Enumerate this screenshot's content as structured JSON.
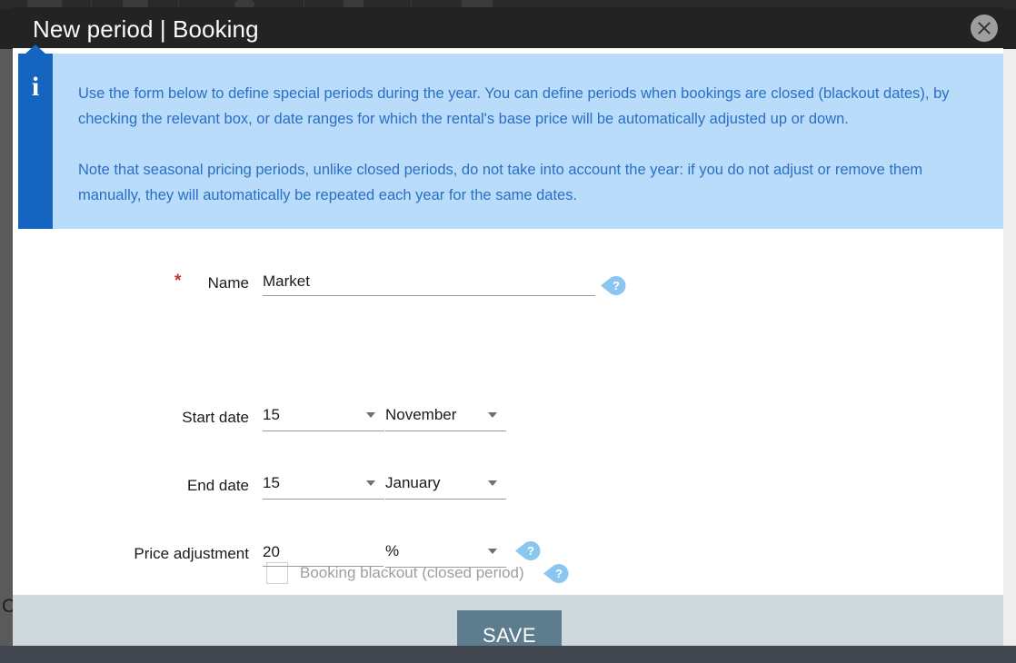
{
  "background": {
    "left_letter": "C"
  },
  "modal": {
    "title": "New period | Booking",
    "close_icon": "close-icon",
    "info": {
      "icon": "info-icon",
      "paragraph1": "Use the form below to define special periods during the year. You can define periods when bookings are closed (blackout dates), by checking the relevant box, or date ranges for which the rental's base price will be automatically adjusted up or down.",
      "paragraph2": "Note that seasonal pricing periods, unlike closed periods, do not take into account the year: if you do not adjust or remove them manually, they will automatically be repeated each year for the same dates."
    },
    "form": {
      "name": {
        "required_marker": "*",
        "label": "Name",
        "value": "Market",
        "placeholder": "",
        "help_icon": "help-icon"
      },
      "blackout": {
        "label": "Booking blackout (closed period)",
        "checked": false,
        "help_icon": "help-icon"
      },
      "start_date": {
        "label": "Start date",
        "day": "15",
        "month": "November"
      },
      "end_date": {
        "label": "End date",
        "day": "15",
        "month": "January"
      },
      "price_adjustment": {
        "label": "Price adjustment",
        "value": "20",
        "unit": "%",
        "help_icon": "help-icon"
      }
    },
    "footer": {
      "save_label": "SAVE"
    }
  },
  "colors": {
    "header_bg": "#232323",
    "info_tab": "#1565c0",
    "info_bg": "#b9dcfa",
    "info_text": "#2a6fc4",
    "help_icon": "#8ac6f0",
    "save_bg": "#5d7d8f",
    "footer_bg": "#cfd8dd",
    "required": "#c0392b"
  }
}
